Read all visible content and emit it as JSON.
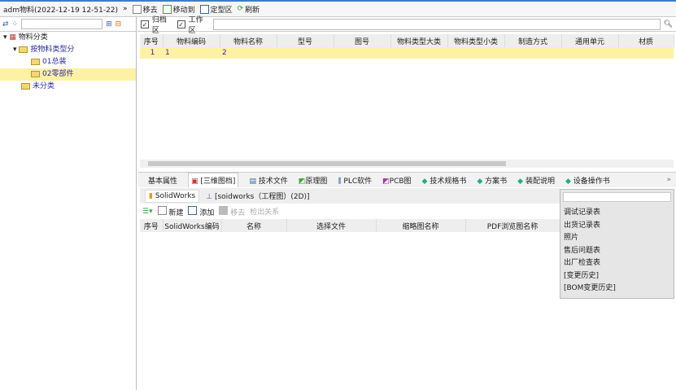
{
  "toolbar": {
    "title": "adm物料(2022-12-19  12-51-22)",
    "remove": "移去",
    "move_to": "移动到",
    "fixed_area": "定型区",
    "refresh": "刷新"
  },
  "tree": {
    "root": "物料分类",
    "group": "按物料类型分",
    "item1": "01总装",
    "item2": "02零部件",
    "unclassified": "未分类"
  },
  "filter": {
    "archive": "归档区",
    "work": "工作区",
    "search_value": ""
  },
  "grid1": {
    "headers": [
      "序号",
      "物料编码",
      "物料名称",
      "型号",
      "图号",
      "物料类型大类",
      "物料类型小类",
      "制造方式",
      "通用单元",
      "材质"
    ],
    "rows": [
      [
        "1",
        "1",
        "2",
        "",
        "",
        "",
        "",
        "",
        "",
        ""
      ]
    ]
  },
  "tabs": [
    "基本属性",
    "[三维图档]",
    "技术文件",
    "原理图",
    "PLC软件",
    "PCB图",
    "技术规格书",
    "方案书",
    "装配说明",
    "设备操作书"
  ],
  "subtabs": [
    "SolidWorks",
    "[soidworks（工程图）(2D)]"
  ],
  "toolbar2": {
    "new": "新建",
    "add": "添加",
    "remove": "移去",
    "checkout": "检出关系"
  },
  "grid2": {
    "headers": [
      "序号",
      "SolidWorks编码",
      "名称",
      "选择文件",
      "缩略图名称",
      "PDF浏览图名称"
    ]
  },
  "dropdown": {
    "items": [
      "调试记录表",
      "出货记录表",
      "照片",
      "售后问题表",
      "出厂检查表",
      "[变更历史]",
      "[BOM变更历史]"
    ]
  }
}
